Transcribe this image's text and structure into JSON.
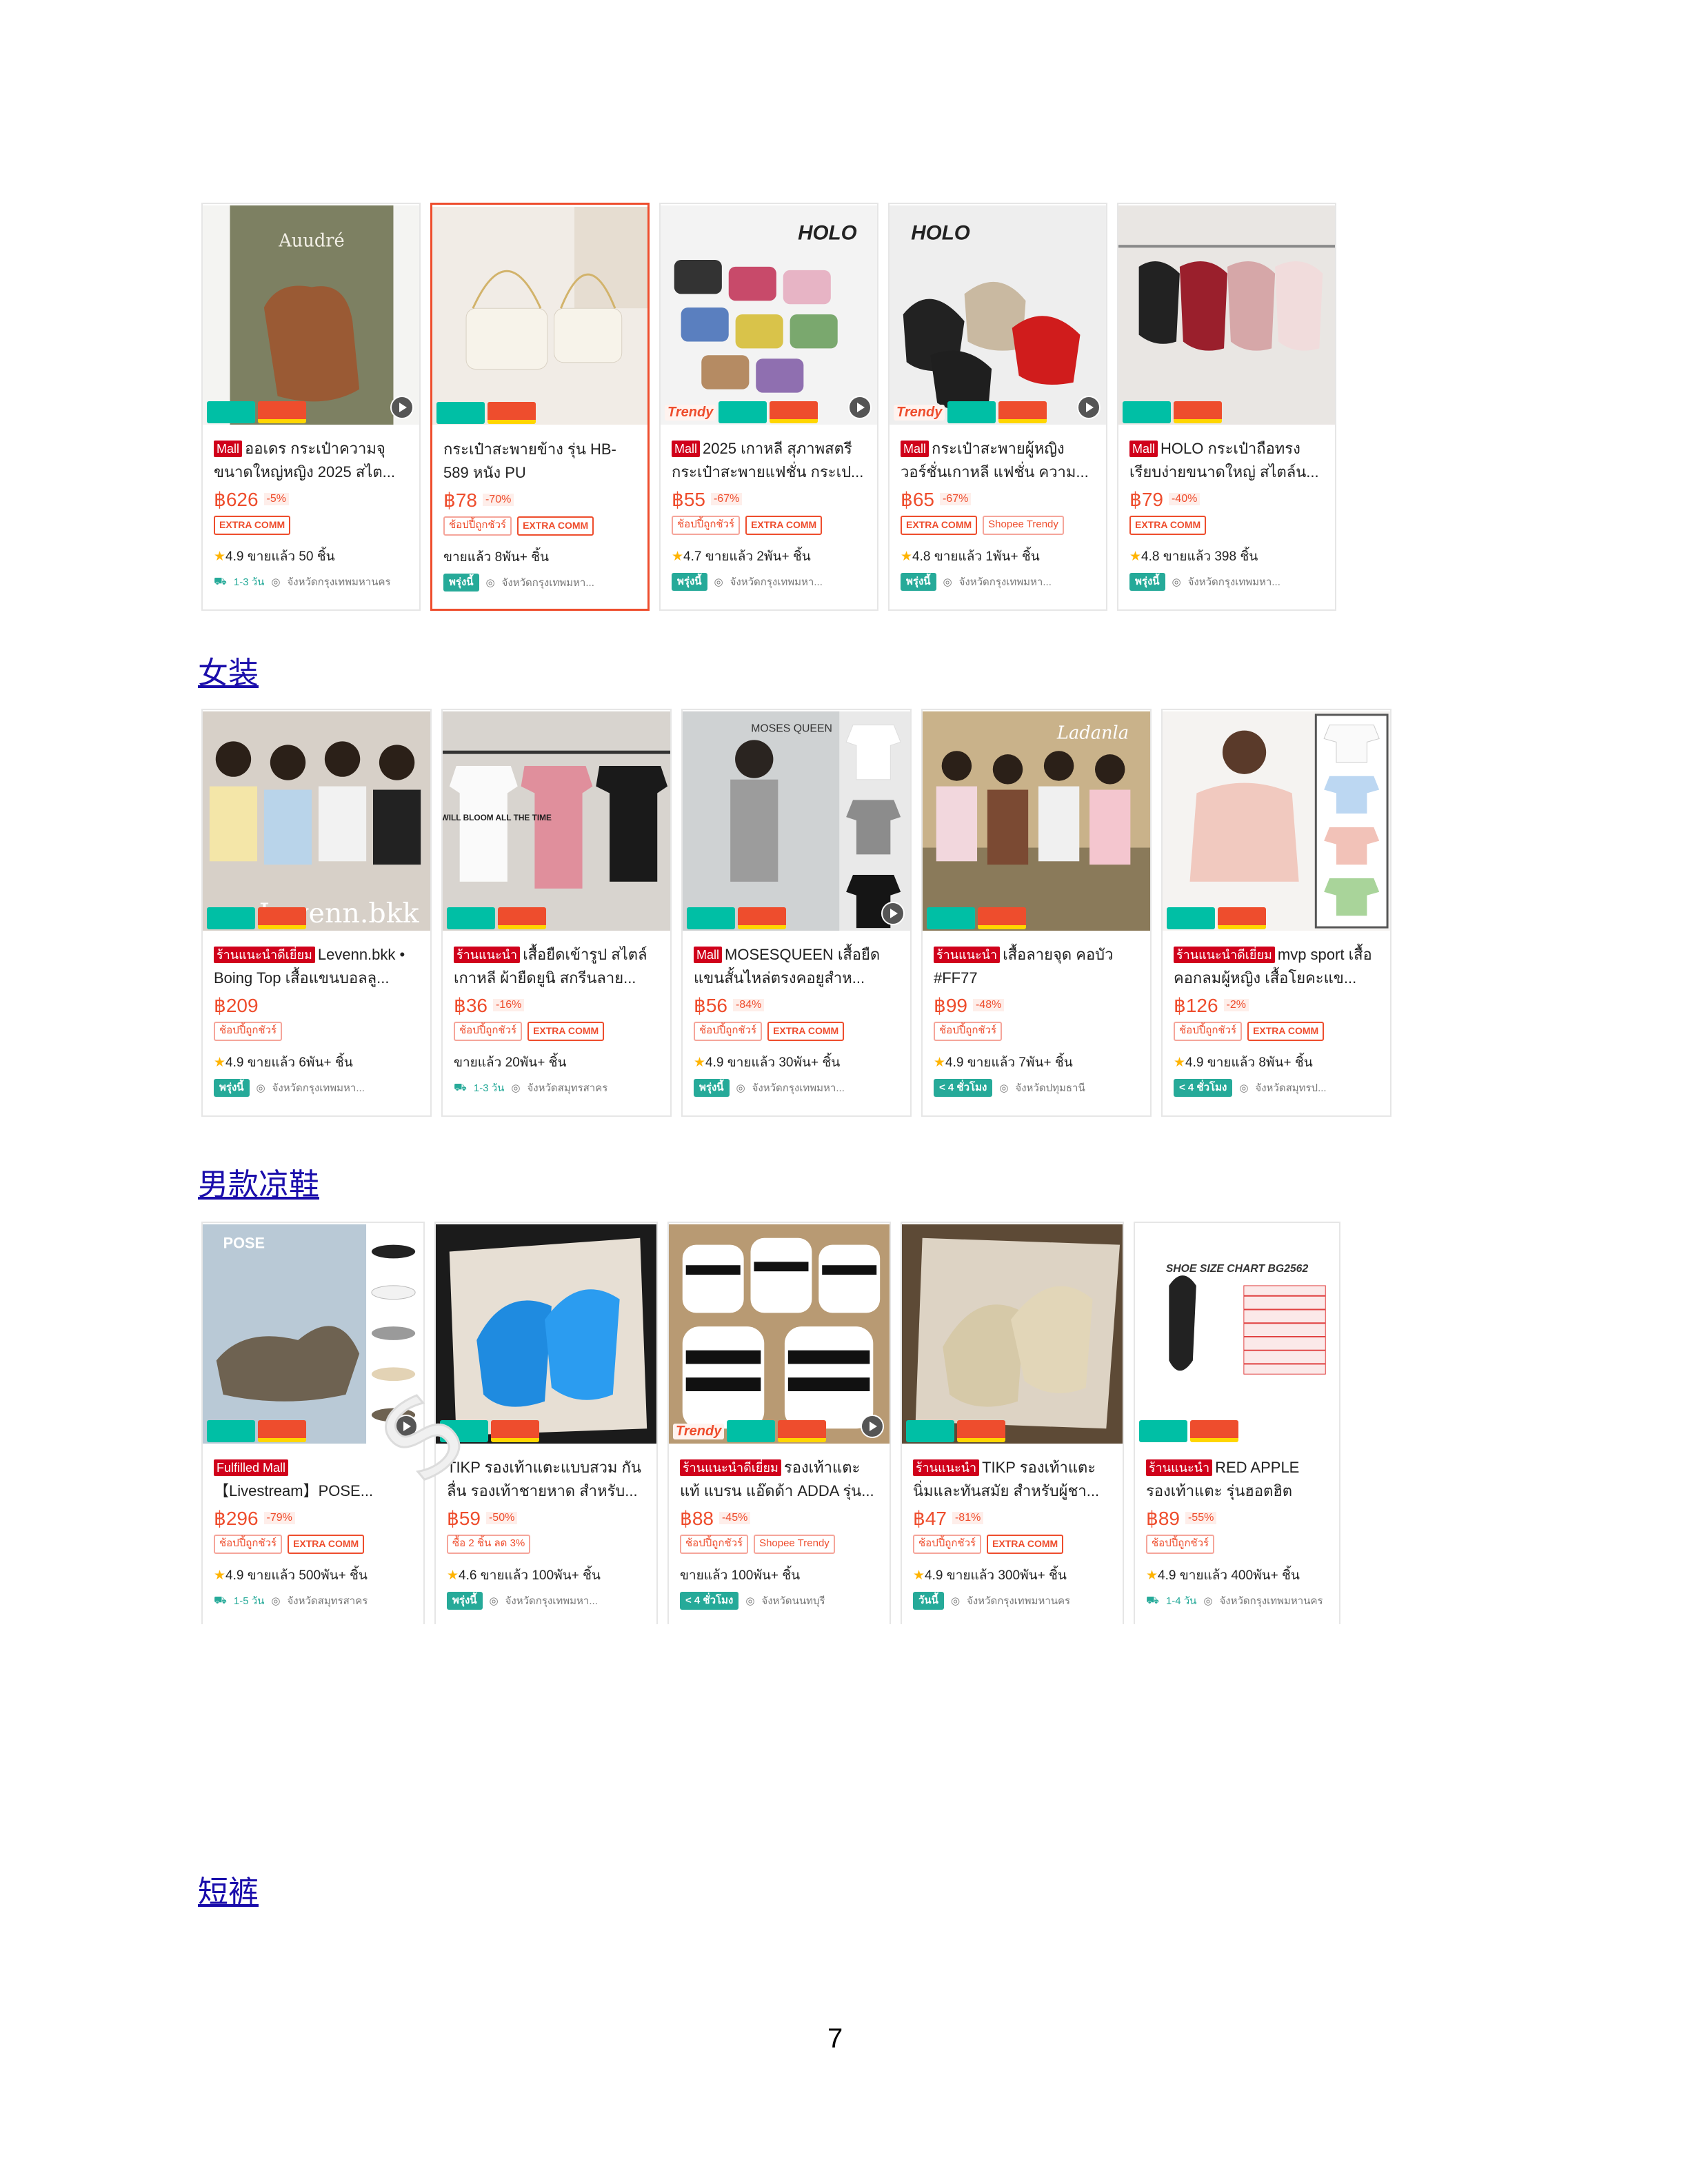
{
  "page_number": "7",
  "sections": {
    "womens_clothing": "女装",
    "mens_sandals": "男款凉鞋",
    "shorts": "短裤"
  },
  "bags": [
    {
      "tag": "Mall",
      "title": "ออเดร กระเป๋าความจุขนาดใหญ่หญิง 2025 สไต...",
      "price": "฿626",
      "discount": "-5%",
      "chips": [
        "EXTRA COMM"
      ],
      "sold": "4.9  ขายแล้ว 50 ชิ้น",
      "ship": "1-3 วัน",
      "location": "จังหวัดกรุงเทพมหานคร",
      "image_label": "Auudré"
    },
    {
      "tag": "",
      "title": "กระเป๋าสะพายข้าง รุ่น HB-589 หนัง PU",
      "price": "฿78",
      "discount": "-70%",
      "chips": [
        "ช้อปปี้ถูกชัวร์",
        "EXTRA COMM"
      ],
      "sold": "ขายแล้ว 8พัน+ ชิ้น",
      "ship": "พรุ่งนี้",
      "location": "จังหวัดกรุงเทพมหา...",
      "image_label": ""
    },
    {
      "tag": "Mall",
      "title": "2025 เกาหลี สุภาพสตรี กระเป๋าสะพายแฟชั่น กระเป...",
      "price": "฿55",
      "discount": "-67%",
      "chips": [
        "ช้อปปี้ถูกชัวร์",
        "EXTRA COMM"
      ],
      "sold": "4.7  ขายแล้ว 2พัน+ ชิ้น",
      "ship": "พรุ่งนี้",
      "location": "จังหวัดกรุงเทพมหา...",
      "image_label": "HOLO"
    },
    {
      "tag": "Mall",
      "title": "กระเป๋าสะพายผู้หญิง วอร์ชั่นเกาหลี แฟชั่น ความ...",
      "price": "฿65",
      "discount": "-67%",
      "chips": [
        "EXTRA COMM",
        "Shopee Trendy"
      ],
      "sold": "4.8  ขายแล้ว 1พัน+ ชิ้น",
      "ship": "พรุ่งนี้",
      "location": "จังหวัดกรุงเทพมหา...",
      "image_label": "HOLO"
    },
    {
      "tag": "Mall",
      "title": "HOLO กระเป๋าถือทรงเรียบง่ายขนาดใหญ่ สไตล์น...",
      "price": "฿79",
      "discount": "-40%",
      "chips": [
        "EXTRA COMM"
      ],
      "sold": "4.8  ขายแล้ว 398 ชิ้น",
      "ship": "พรุ่งนี้",
      "location": "จังหวัดกรุงเทพมหา...",
      "image_label": ""
    }
  ],
  "tops": [
    {
      "tag": "ร้านแนะนำดีเยี่ยม",
      "title": "Levenn.bkk • Boing Top  เสื้อแขนบอลลู...",
      "price": "฿209",
      "discount": "",
      "chips": [
        "ช้อปปี้ถูกชัวร์"
      ],
      "sold": "4.9  ขายแล้ว 6พัน+ ชิ้น",
      "ship": "พรุ่งนี้",
      "location": "จังหวัดกรุงเทพมหา...",
      "image_label": "Levenn.bkk"
    },
    {
      "tag": "ร้านแนะนำ",
      "title": "เสื้อยืดเข้ารูป สไตล์เกาหลี ผ้ายืดยูนิ สกรีนลาย...",
      "price": "฿36",
      "discount": "-16%",
      "chips": [
        "ช้อปปี้ถูกชัวร์",
        "EXTRA COMM"
      ],
      "sold": "ขายแล้ว 20พัน+ ชิ้น",
      "ship": "1-3 วัน",
      "location": "จังหวัดสมุทรสาคร",
      "image_label": "BOSE WILL BLOOM ALL THE TIME"
    },
    {
      "tag": "Mall",
      "title": "MOSESQUEEN เสื้อยืดแขนสั้นไหล่ตรงคอยูสำห...",
      "price": "฿56",
      "discount": "-84%",
      "chips": [
        "ช้อปปี้ถูกชัวร์",
        "EXTRA COMM"
      ],
      "sold": "4.9  ขายแล้ว 30พัน+ ชิ้น",
      "ship": "พรุ่งนี้",
      "location": "จังหวัดกรุงเทพมหา...",
      "image_label": "MOSES QUEEN"
    },
    {
      "tag": "ร้านแนะนำ",
      "title": "เสื้อลายจุด คอบัว #FF77",
      "price": "฿99",
      "discount": "-48%",
      "chips": [
        "ช้อปปี้ถูกชัวร์"
      ],
      "sold": "4.9  ขายแล้ว 7พัน+ ชิ้น",
      "ship": "< 4 ชั่วโมง",
      "location": "จังหวัดปทุมธานี",
      "image_label": "Ladanla"
    },
    {
      "tag": "ร้านแนะนำดีเยี่ยม",
      "title": "mvp sport เสื้อคอกลมผู้หญิง เสื้อโยคะแข...",
      "price": "฿126",
      "discount": "-2%",
      "chips": [
        "ช้อปปี้ถูกชัวร์",
        "EXTRA COMM"
      ],
      "sold": "4.9  ขายแล้ว 8พัน+ ชิ้น",
      "ship": "< 4 ชั่วโมง",
      "location": "จังหวัดสมุทรป...",
      "image_label": ""
    }
  ],
  "sandals": [
    {
      "tag": "Fulfilled Mall",
      "title": "【Livestream】POSE...",
      "price": "฿296",
      "discount": "-79%",
      "chips": [
        "ช้อปปี้ถูกชัวร์",
        "EXTRA COMM"
      ],
      "sold": "4.9  ขายแล้ว 500พัน+ ชิ้น",
      "ship": "1-5 วัน",
      "location": "จังหวัดสมุทรสาคร",
      "image_label": "POSE"
    },
    {
      "tag": "",
      "title": "TIKP รองเท้าแตะแบบสวม กันลื่น รองเท้าชายหาด สำหรับ...",
      "price": "฿59",
      "discount": "-50%",
      "chips": [
        "ซื้อ 2 ชิ้น ลด 3%"
      ],
      "sold": "4.6  ขายแล้ว 100พัน+ ชิ้น",
      "ship": "พรุ่งนี้",
      "location": "จังหวัดกรุงเทพมหา...",
      "image_label": ""
    },
    {
      "tag": "ร้านแนะนำดีเยี่ยม",
      "title": "รองเท้าแตะ แท้ แบรน แอ๊ดด้า ADDA รุ่น...",
      "price": "฿88",
      "discount": "-45%",
      "chips": [
        "ช้อปปี้ถูกชัวร์",
        "Shopee Trendy"
      ],
      "sold": "ขายแล้ว 100พัน+ ชิ้น",
      "ship": "< 4 ชั่วโมง",
      "location": "จังหวัดนนทบุรี",
      "image_label": ""
    },
    {
      "tag": "ร้านแนะนำ",
      "title": "TIKP รองเท้าแตะ นิ่มและทันสมัย สำหรับผู้ชา...",
      "price": "฿47",
      "discount": "-81%",
      "chips": [
        "ช้อปปี้ถูกชัวร์",
        "EXTRA COMM"
      ],
      "sold": "4.9  ขายแล้ว 300พัน+ ชิ้น",
      "ship": "วันนี้",
      "location": "จังหวัดกรุงเทพมหานคร",
      "image_label": ""
    },
    {
      "tag": "ร้านแนะนำ",
      "title": "RED APPLE รองเท้าแตะ รุ่นฮอตฮิต หน้า...",
      "price": "฿89",
      "discount": "-55%",
      "chips": [
        "ช้อปปี้ถูกชัวร์"
      ],
      "sold": "4.9  ขายแล้ว 400พัน+ ชิ้น",
      "ship": "1-4 วัน",
      "location": "จังหวัดกรุงเทพมหานคร",
      "image_label": "SHOE SIZE CHART  BG2562"
    }
  ]
}
